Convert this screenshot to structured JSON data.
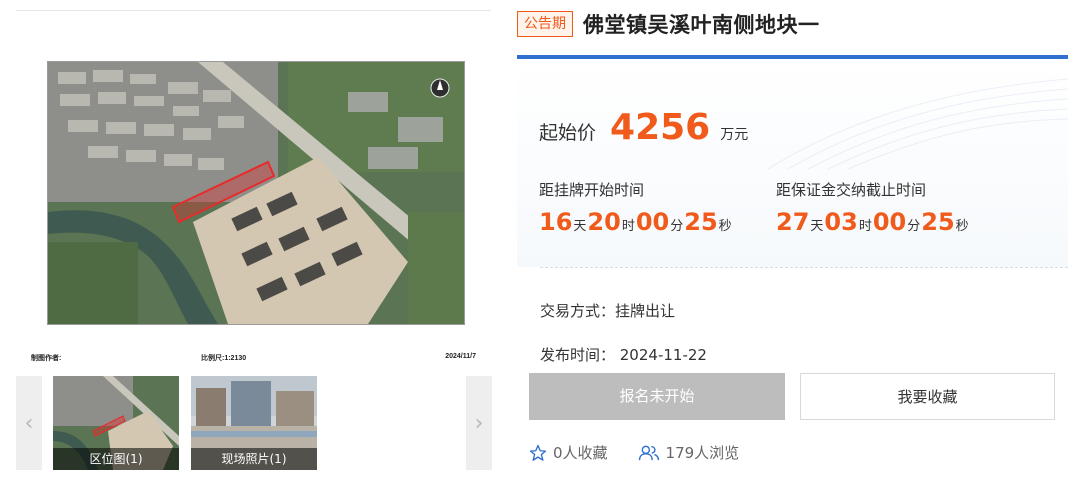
{
  "gallery": {
    "main_image": {
      "kind": "aerial-map",
      "footer": {
        "author": "制图作者:",
        "scale": "比例尺:1:2130",
        "date": "2024/11/7"
      }
    },
    "prev_icon": "chevron-left-icon",
    "next_icon": "chevron-right-icon",
    "thumbnails": [
      {
        "caption": "区位图(1)"
      },
      {
        "caption": "现场照片(1)"
      }
    ]
  },
  "listing": {
    "status": "公告期",
    "title": "佛堂镇吴溪叶南侧地块一",
    "price": {
      "label": "起始价",
      "value": "4256",
      "unit": "万元"
    },
    "countdowns": [
      {
        "label": "距挂牌开始时间",
        "days": "16",
        "hours": "20",
        "minutes": "00",
        "seconds": "25"
      },
      {
        "label": "距保证金交纳截止时间",
        "days": "27",
        "hours": "03",
        "minutes": "00",
        "seconds": "25"
      }
    ],
    "units": {
      "day": "天",
      "hour": "时",
      "minute": "分",
      "second": "秒"
    },
    "trade_method": "交易方式：挂牌出让",
    "publish_time": "发布时间：  2024-11-22",
    "buttons": {
      "signup": "报名未开始",
      "favorite": "我要收藏"
    },
    "stats": {
      "favorites": "0人收藏",
      "views": "179人浏览"
    }
  },
  "colors": {
    "accent": "#f05a1a",
    "panel_border": "#2e6fcf",
    "disabled_button": "#bdbdbd"
  }
}
